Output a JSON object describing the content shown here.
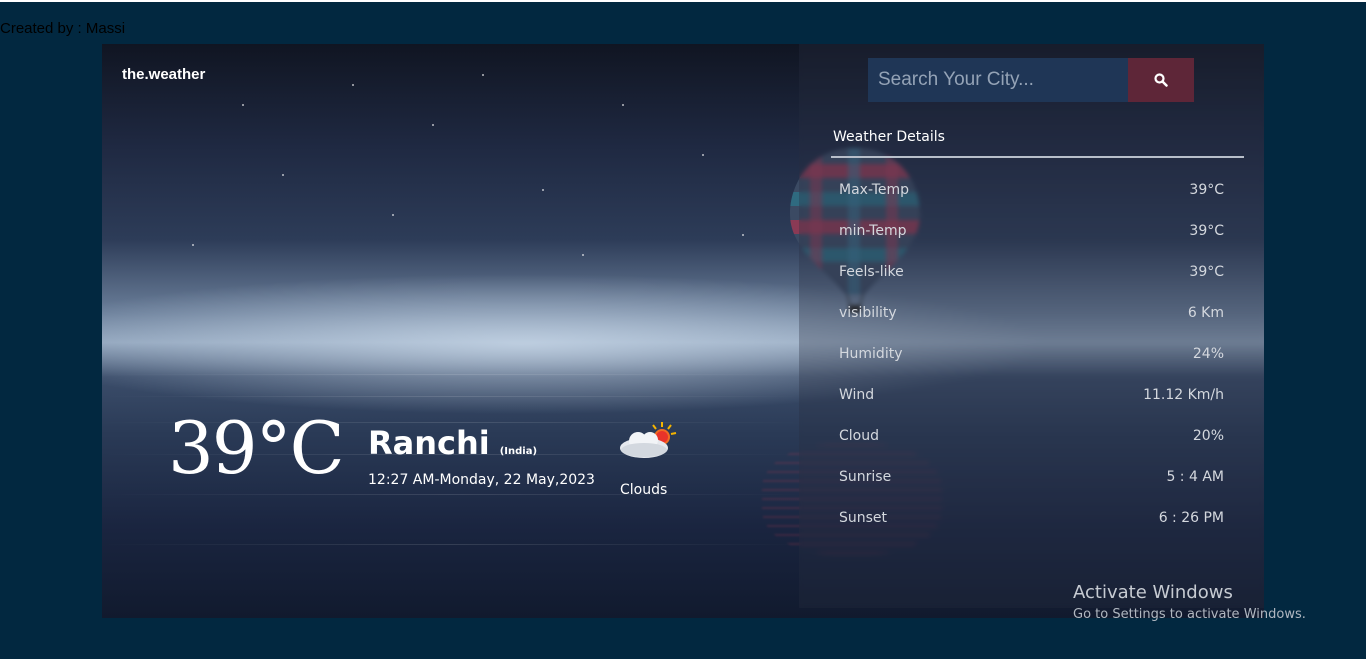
{
  "credit": "Created by : Massi",
  "brand": "the.weather",
  "search": {
    "placeholder": "Search Your City...",
    "icon": "search-icon"
  },
  "current": {
    "temperature": "39°C",
    "city": "Ranchi",
    "country": "(India)",
    "datetime": "12:27 AM-Monday, 22 May,2023",
    "condition": "Clouds",
    "condition_icon": "partly-cloudy-sun-icon"
  },
  "details": {
    "title": "Weather Details",
    "rows": [
      {
        "label": "Max-Temp",
        "value": "39°C"
      },
      {
        "label": "min-Temp",
        "value": "39°C"
      },
      {
        "label": "Feels-like",
        "value": "39°C"
      },
      {
        "label": "visibility",
        "value": "6 Km"
      },
      {
        "label": "Humidity",
        "value": "24%"
      },
      {
        "label": "Wind",
        "value": "11.12 Km/h"
      },
      {
        "label": "Cloud",
        "value": "20%"
      },
      {
        "label": "Sunrise",
        "value": "5 : 4 AM"
      },
      {
        "label": "Sunset",
        "value": "6 : 26 PM"
      }
    ]
  },
  "watermark": {
    "line1": "Activate Windows",
    "line2": "Go to Settings to activate Windows."
  },
  "colors": {
    "page_bg": "#022840",
    "search_bg": "#1f3656",
    "search_button": "#5e2638"
  }
}
